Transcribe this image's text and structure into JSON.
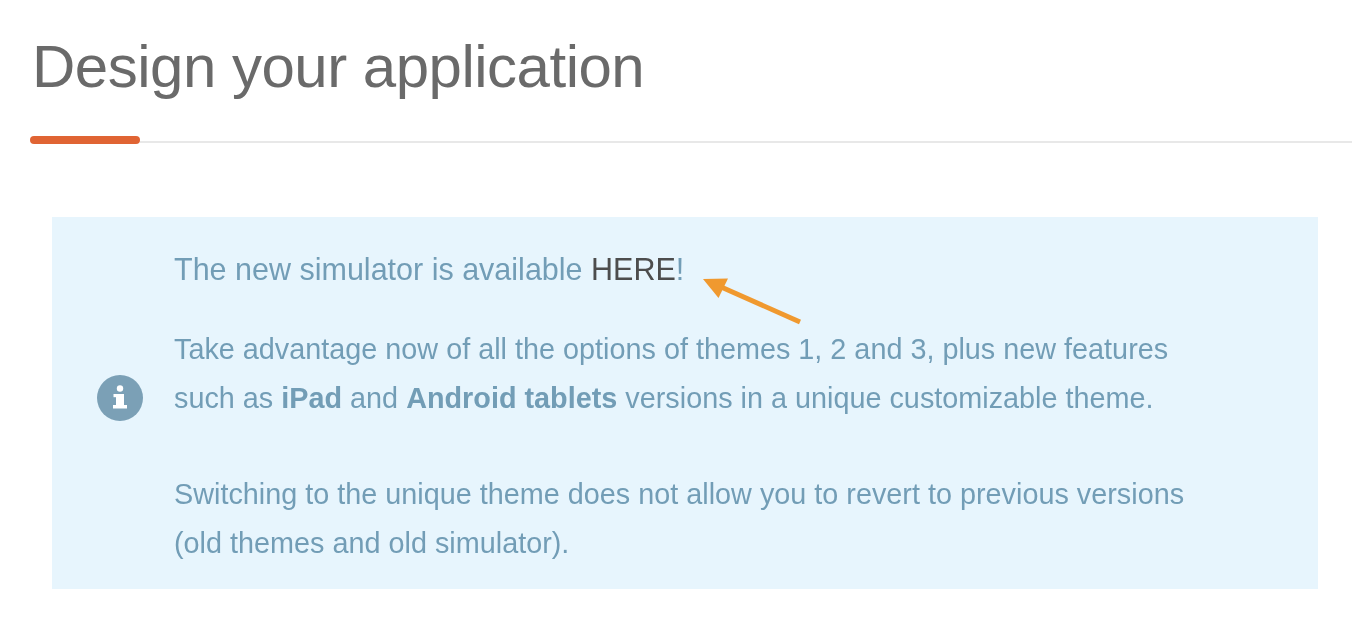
{
  "page": {
    "title": "Design your application"
  },
  "notice": {
    "lead": {
      "text": "The new simulator is available",
      "link": "HERE",
      "after": "!"
    },
    "paragraphs": [
      "Take advantage now of all the options of themes 1, 2 and 3, plus new features such as **iPad** and **Android tablets** versions in a unique customizable theme.",
      "Switching to the unique theme does not allow you to revert to previous versions (old themes and old simulator)."
    ]
  }
}
